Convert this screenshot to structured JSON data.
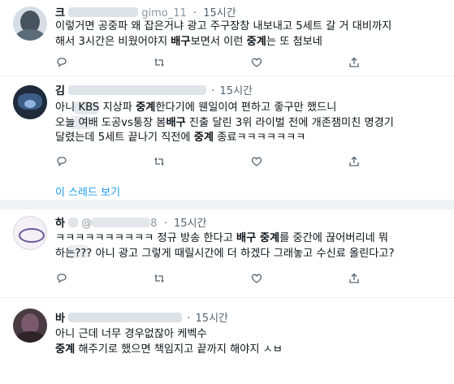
{
  "tweets": [
    {
      "name": "크",
      "handle": "gimo_11",
      "time": "15시간",
      "lines": [
        [
          "이렇거면 공중파 왜 잡은거냐 광고 주구장창 내보내고 5세트 갈 거 대비까지"
        ],
        [
          "해서 3시간은 비웠어야지 ",
          {
            "b": "배구"
          },
          "보면서 이런 ",
          {
            "b": "중계"
          },
          "는 또 첨보네"
        ]
      ]
    },
    {
      "name": "김",
      "handle": "",
      "time": "15시간",
      "lines": [
        [
          "아니",
          " KBS 지상파 ",
          {
            "b": "중계"
          },
          "한다기에 웬일이여 편하고 좋구만 했드니"
        ],
        [
          "오늘 여배 도공vs통장 봄",
          {
            "b": "배구"
          },
          " 진출 달린 3위 라이벌 전에 개존잼미친 명경기"
        ],
        [
          "달렸는데 5세트 끝나기 직전에 ",
          {
            "b": "중계"
          },
          " 종료ㅋㅋㅋㅋㅋㅋㅋ"
        ]
      ],
      "thread_link": "이 스레드 보기"
    },
    {
      "name": "하",
      "handle": "@",
      "handle_tail": "8",
      "time": "15시간",
      "lines": [
        [
          "ㅋㅋㅋㅋㅋㅋㅋㅋㅋㅋ 정규 방송 한다고 ",
          {
            "b": "배구 중계"
          },
          "를 중간에 끊어버리네 뭐"
        ],
        [
          "하는??? 아니 광고 그렇게 때릴시간에 더 하겠다 그래놓고 수신료 올린다고?"
        ]
      ]
    },
    {
      "name": "바",
      "handle": "",
      "time": "15시간",
      "lines": [
        [
          "아니 근데 너무 경우없잖아 케벡수"
        ],
        [
          {
            "b": "중계"
          },
          " 해주기로 했으면 책임지고 끝까지 해야지 ㅅㅂ"
        ]
      ]
    }
  ],
  "icons": [
    "reply-icon",
    "retweet-icon",
    "like-icon",
    "share-icon"
  ],
  "colors": {
    "link": "#1d9bf0",
    "secondary": "#536471",
    "border": "#eff3f4"
  }
}
